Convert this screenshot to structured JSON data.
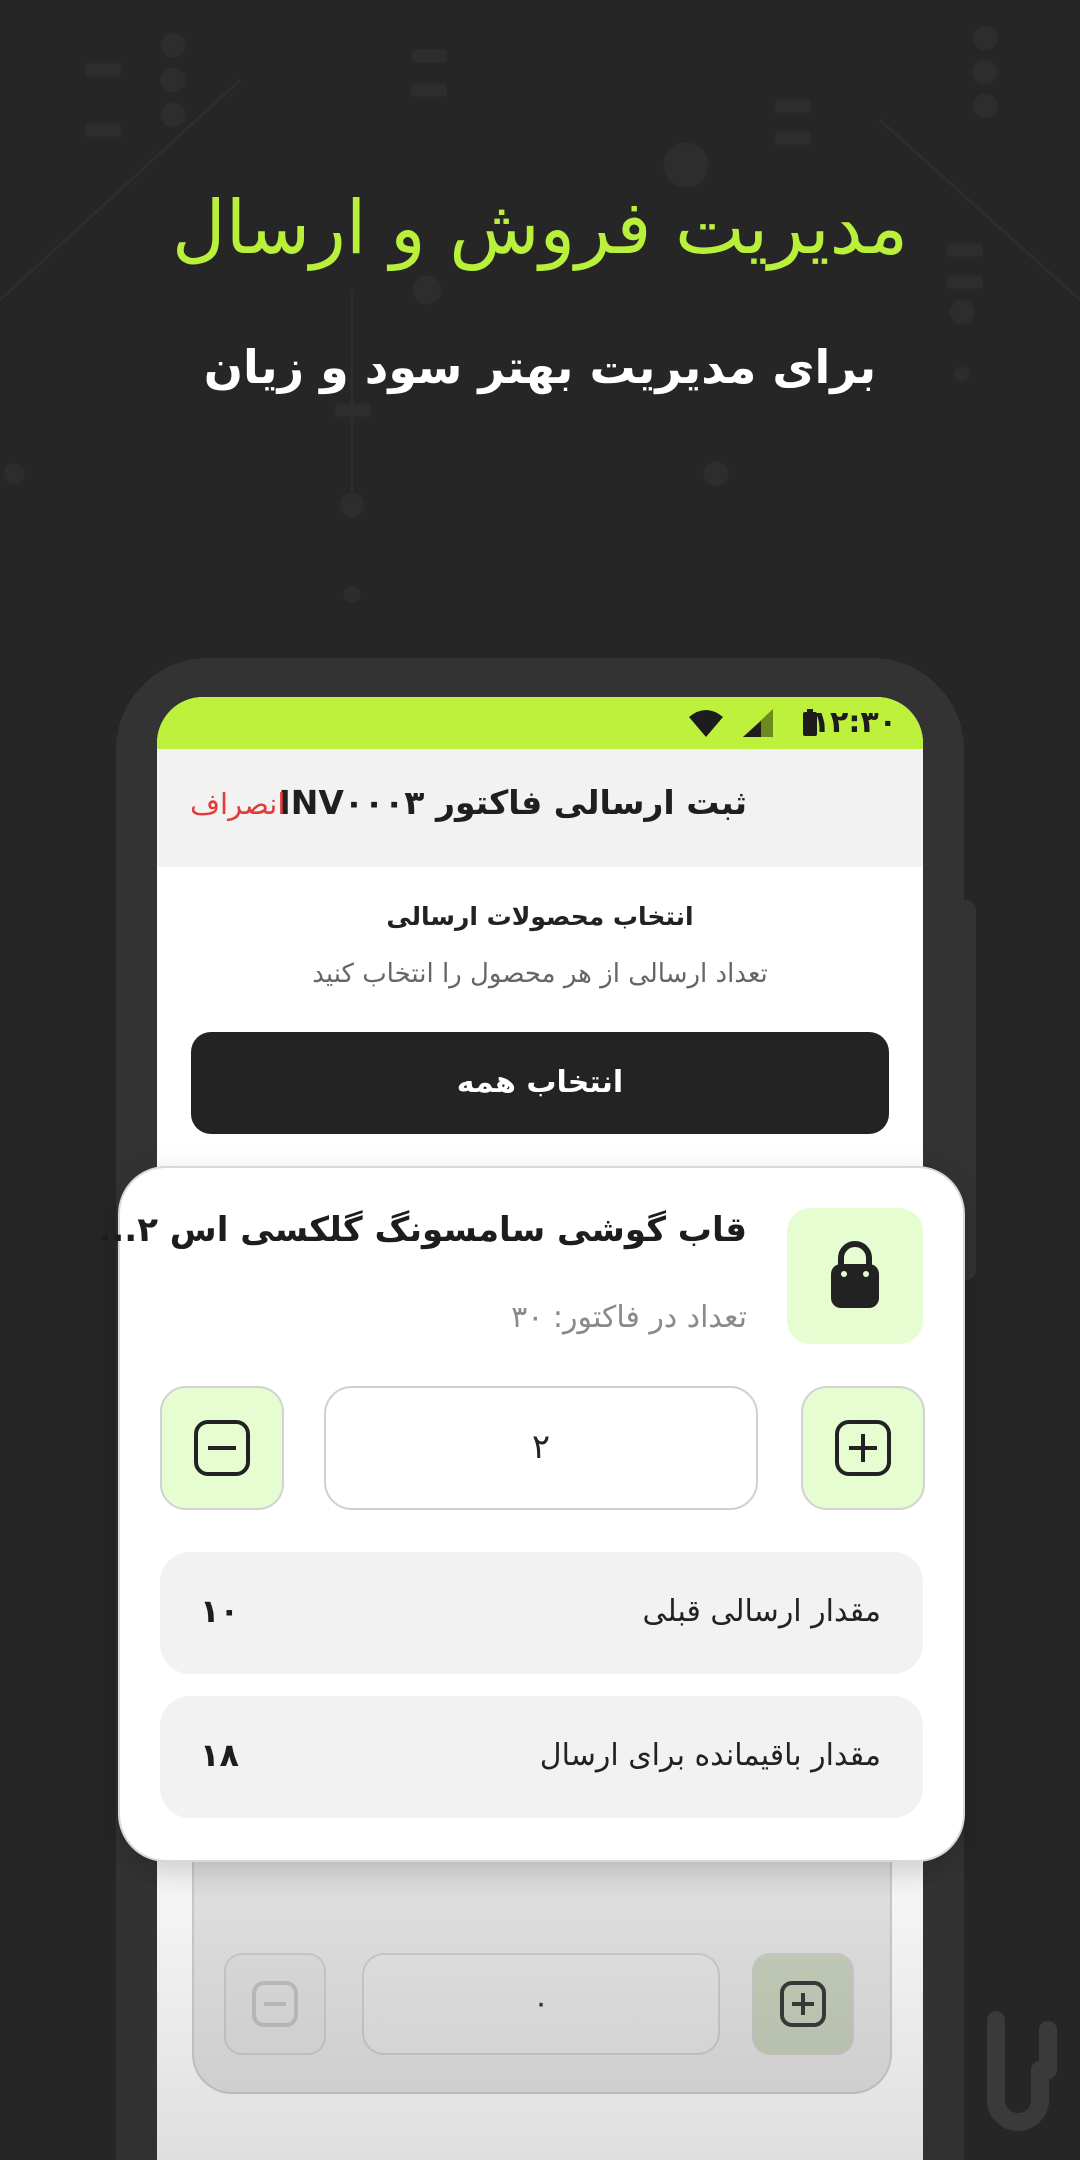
{
  "colors": {
    "accent": "#BDF13C",
    "headline": "#B8F03C",
    "danger": "#E23B3B",
    "background": "#262626",
    "soft_green": "#E6FDD2"
  },
  "hero": {
    "title": "مدیریت فروش و ارسال",
    "subtitle": "برای مدیریت بهتر سود و زیان"
  },
  "status_bar": {
    "time": "۱۲:۳۰",
    "icons": [
      "wifi-icon",
      "signal-icon",
      "battery-icon"
    ]
  },
  "appbar": {
    "title": "ثبت ارسالی فاکتور INV۰۰۰۳",
    "cancel_label": "انصراف"
  },
  "section": {
    "title": "انتخاب محصولات ارسالی",
    "subtitle": "تعداد ارسالی از هر محصول را انتخاب کنید",
    "select_all_label": "انتخاب همه"
  },
  "product": {
    "icon": "shopping-bag-icon",
    "name": "قاب گوشی سامسونگ گلکسی اس ۲...",
    "invoice_qty": "تعداد در فاکتور: ۳۰",
    "quantity_value": "۲",
    "rows": [
      {
        "label": "مقدار ارسالی قبلی",
        "value": "۱۰"
      },
      {
        "label": "مقدار باقیمانده برای ارسال",
        "value": "۱۸"
      }
    ]
  },
  "next_product": {
    "quantity_value": "۰"
  }
}
